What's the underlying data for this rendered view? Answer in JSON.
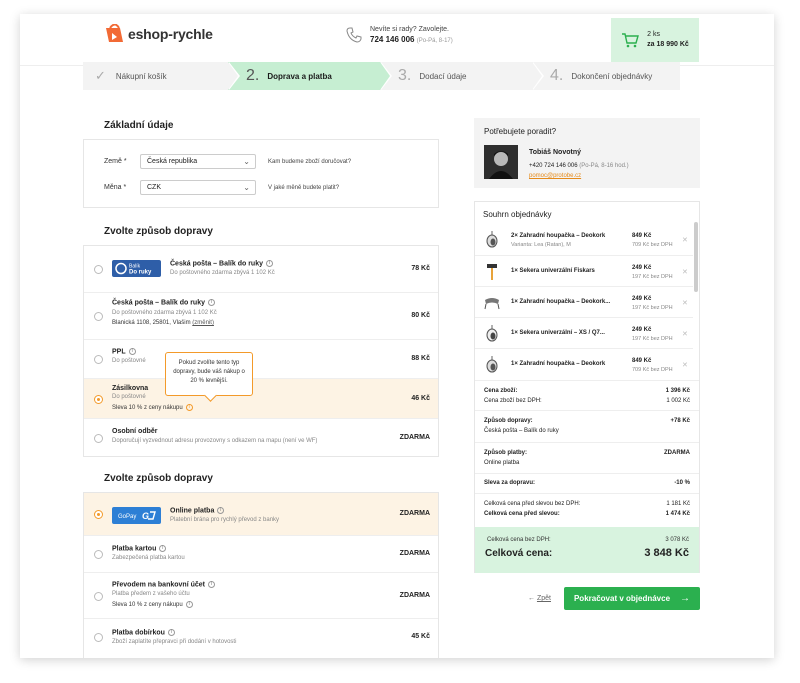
{
  "header": {
    "logo_text": "eshop-rychle",
    "contact_question": "Nevíte si rady? Zavolejte.",
    "contact_phone": "724 146 006",
    "contact_hours": "(Po-Pá, 8-17)",
    "cart_count": "2 ks",
    "cart_total": "za 18 990 Kč"
  },
  "steps": [
    {
      "label": "Nákupní košík",
      "num": "✓"
    },
    {
      "label": "Doprava a platba",
      "num": "2."
    },
    {
      "label": "Dodací údaje",
      "num": "3."
    },
    {
      "label": "Dokončení objednávky",
      "num": "4."
    }
  ],
  "basic": {
    "title": "Základní údaje",
    "country_label": "Země *",
    "country_value": "Česká republika",
    "country_hint": "Kam budeme zboží doručovat?",
    "currency_label": "Měna *",
    "currency_value": "CZK",
    "currency_hint": "V jaké měně budete platit?"
  },
  "shipping": {
    "title": "Zvolte způsob dopravy",
    "options": [
      {
        "title": "Česká pošta – Balík do ruky",
        "sub": "Do poštovného zdarma zbývá 1 102 Kč",
        "price": "78 Kč",
        "logo_text": "Balík Do ruky"
      },
      {
        "title": "Česká pošta – Balík do ruky",
        "sub": "Do poštovného zdarma zbývá 1 102 Kč",
        "sub2": "Blanická 1108, 25801, Vlašim",
        "sub2_link": "(změnit)",
        "price": "80 Kč"
      },
      {
        "title": "PPL",
        "sub": "Do poštovné",
        "price": "88 Kč"
      },
      {
        "title": "Zásilkovna",
        "sub": "Do poštovné",
        "sub2": "Sleva 10 % z ceny nákupu",
        "price": "46 Kč"
      },
      {
        "title": "Osobní odběr",
        "sub": "Doporučují vyzvednout adresu provozovny s odkazem na mapu (není ve WF)",
        "price": "ZDARMA"
      }
    ],
    "tooltip": "Pokud zvolíte tento typ dopravy, bude váš nákup o 20 % levnější."
  },
  "payment": {
    "title": "Zvolte způsob dopravy",
    "options": [
      {
        "title": "Online platba",
        "sub": "Platební brána pro rychlý převod z banky",
        "price": "ZDARMA",
        "logo_text": "GoPay"
      },
      {
        "title": "Platba kartou",
        "sub": "Zabezpečená platba kartou",
        "price": "ZDARMA"
      },
      {
        "title": "Převodem na bankovní účet",
        "sub": "Platba předem z vašeho účtu",
        "sub2": "Sleva 10 % z ceny nákupu",
        "price": "ZDARMA"
      },
      {
        "title": "Platba dobírkou",
        "sub": "Zboží zaplatíte přepravci při dodání v hotovosti",
        "price": "45 Kč"
      }
    ]
  },
  "help": {
    "title": "Potřebujete poradit?",
    "name": "Tobiáš Novotný",
    "phone": "+420 724 146 006",
    "hours": "(Po-Pá, 8-16 hod.)",
    "email": "pomoc@protobe.cz"
  },
  "summary": {
    "title": "Souhrn objednávky",
    "items": [
      {
        "qty": "2×",
        "name": "Zahradní houpačka – Deokork",
        "variant": "Varianta: Lea (Ratan), M",
        "price": "849 Kč",
        "price_nv": "709 Kč bez DPH"
      },
      {
        "qty": "1×",
        "name": "Sekera univerzální Fiskars",
        "variant": "",
        "price": "249 Kč",
        "price_nv": "197 Kč bez DPH"
      },
      {
        "qty": "1×",
        "name": "Zahradní houpačka – Deokork...",
        "variant": "",
        "price": "249 Kč",
        "price_nv": "197 Kč bez DPH"
      },
      {
        "qty": "1×",
        "name": "Sekera univerzální – XS / Q7...",
        "variant": "",
        "price": "249 Kč",
        "price_nv": "197 Kč bez DPH"
      },
      {
        "qty": "1×",
        "name": "Zahradní houpačka – Deokork",
        "variant": "",
        "price": "849 Kč",
        "price_nv": "709 Kč bez DPH"
      }
    ],
    "goods_price_label": "Cena zboží:",
    "goods_price": "1 396 Kč",
    "goods_price_nv_label": "Cena zboží bez DPH:",
    "goods_price_nv": "1 002 Kč",
    "shipping_label": "Způsob dopravy:",
    "shipping_value": "Česká pošta – Balík do ruky",
    "shipping_price": "+78 Kč",
    "payment_label": "Způsob platby:",
    "payment_value": "Online platba",
    "payment_price": "ZDARMA",
    "discount_label": "Sleva za dopravu:",
    "discount_value": "-10 %",
    "before_nv_label": "Celková cena před slevou bez DPH:",
    "before_nv": "1 181 Kč",
    "before_label": "Celková cena před slevou:",
    "before": "1 474 Kč",
    "total_nv_label": "Celková cena bez DPH:",
    "total_nv": "3 078 Kč",
    "total_label": "Celková cena:",
    "total": "3 848 Kč"
  },
  "actions": {
    "back_arrow": "←",
    "back_label": "Zpět",
    "continue_label": "Pokračovat v objednávce",
    "continue_arrow": "→"
  },
  "colors": {
    "accent_green": "#2bb04f",
    "accent_orange": "#f39a2a",
    "light_green": "#d8f3df"
  }
}
